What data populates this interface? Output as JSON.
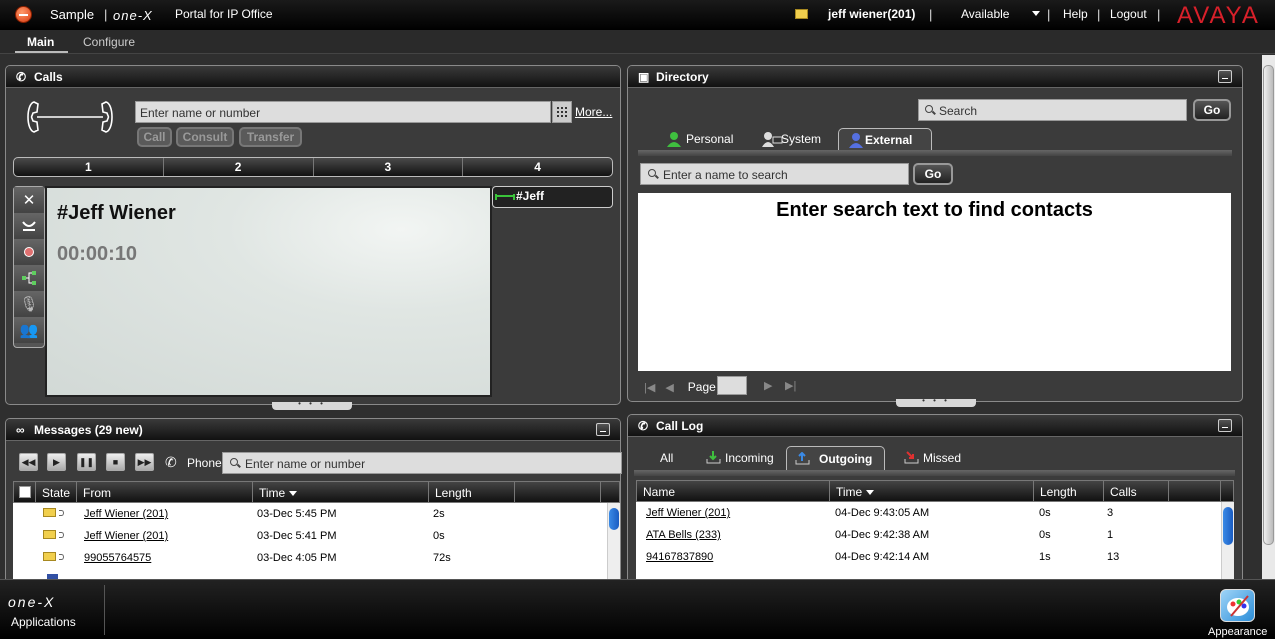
{
  "topbar": {
    "app_name": "Sample",
    "logo": "one-X",
    "portal_title": "Portal for IP Office",
    "user": "jeff wiener(201)",
    "status": "Available",
    "help": "Help",
    "logout": "Logout",
    "brand": "AVAYA"
  },
  "nav": {
    "main": "Main",
    "configure": "Configure"
  },
  "calls": {
    "title": "Calls",
    "dial_placeholder": "Enter name or number",
    "more": "More...",
    "buttons": {
      "call": "Call",
      "consult": "Consult",
      "transfer": "Transfer"
    },
    "lines": [
      "1",
      "2",
      "3",
      "4"
    ],
    "active_call": {
      "name": "#Jeff Wiener",
      "duration": "00:00:10",
      "tag": "#Jeff"
    }
  },
  "directory": {
    "title": "Directory",
    "search_placeholder": "Search",
    "go": "Go",
    "tabs": {
      "personal": "Personal",
      "system": "System",
      "external": "External"
    },
    "filter_placeholder": "Enter a name to search",
    "empty_message": "Enter search text to find contacts",
    "page_label": "Page"
  },
  "messages": {
    "title": "Messages (29 new)",
    "phone_label": "Phone",
    "search_placeholder": "Enter name or number",
    "columns": {
      "state": "State",
      "from": "From",
      "time": "Time",
      "length": "Length"
    },
    "rows": [
      {
        "from": "Jeff Wiener (201)",
        "time": "03-Dec 5:45 PM",
        "length": "2s"
      },
      {
        "from": "Jeff Wiener (201)",
        "time": "03-Dec 5:41 PM",
        "length": "0s"
      },
      {
        "from": "99055764575",
        "time": "03-Dec 4:05 PM",
        "length": "72s"
      }
    ]
  },
  "calllog": {
    "title": "Call Log",
    "tabs": {
      "all": "All",
      "incoming": "Incoming",
      "outgoing": "Outgoing",
      "missed": "Missed"
    },
    "columns": {
      "name": "Name",
      "time": "Time",
      "length": "Length",
      "calls": "Calls"
    },
    "rows": [
      {
        "name": "Jeff Wiener (201)",
        "time": "04-Dec 9:43:05 AM",
        "length": "0s",
        "calls": "3"
      },
      {
        "name": "ATA Bells (233)",
        "time": "04-Dec 9:42:38 AM",
        "length": "0s",
        "calls": "1"
      },
      {
        "name": "94167837890",
        "time": "04-Dec 9:42:14 AM",
        "length": "1s",
        "calls": "13"
      }
    ]
  },
  "bottom": {
    "logo": "one-X",
    "applications": "Applications",
    "appearance": "Appearance"
  },
  "colors": {
    "brand_red": "#d8202a",
    "accent_blue": "#1a5cc2",
    "active_green": "#3ac43a"
  }
}
